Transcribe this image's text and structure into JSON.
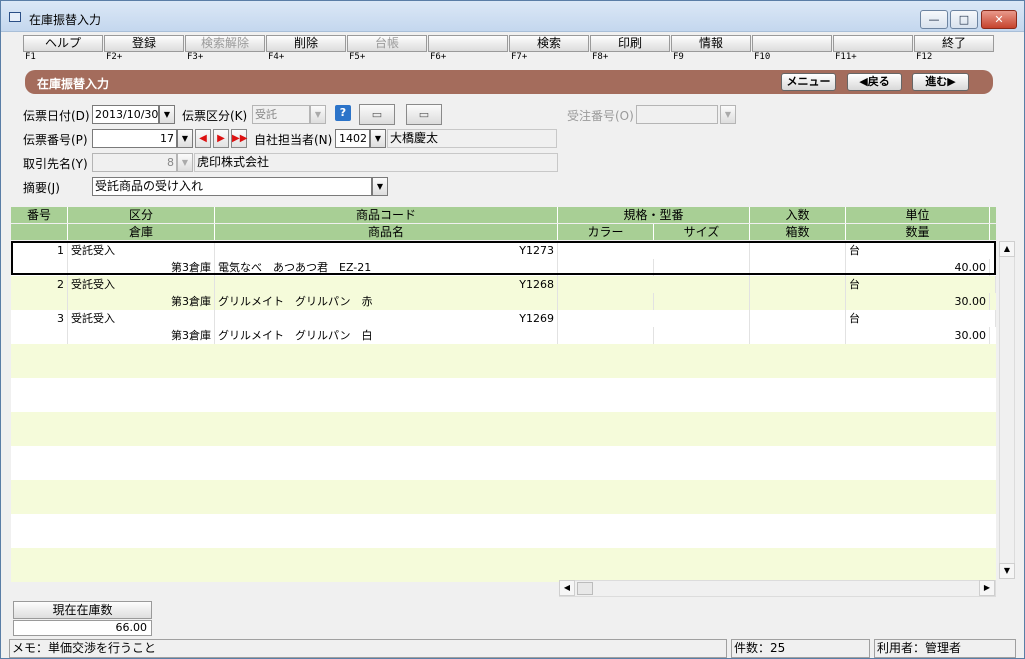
{
  "window": {
    "title": "在庫振替入力",
    "min": "—",
    "max": "□",
    "close": "✕"
  },
  "fkeys": [
    {
      "label": "ヘルプ",
      "code": "F1",
      "disabled": false
    },
    {
      "label": "登録",
      "code": "F2+",
      "disabled": false
    },
    {
      "label": "検索解除",
      "code": "F3+",
      "disabled": true
    },
    {
      "label": "削除",
      "code": "F4+",
      "disabled": false
    },
    {
      "label": "台帳",
      "code": "F5+",
      "disabled": true
    },
    {
      "label": "",
      "code": "F6+",
      "disabled": false
    },
    {
      "label": "検索",
      "code": "F7+",
      "disabled": false
    },
    {
      "label": "印刷",
      "code": "F8+",
      "disabled": false
    },
    {
      "label": "情報",
      "code": "F9",
      "disabled": false
    },
    {
      "label": "",
      "code": "F10",
      "disabled": false
    },
    {
      "label": "",
      "code": "F11+",
      "disabled": false
    },
    {
      "label": "終了",
      "code": "F12",
      "disabled": false
    }
  ],
  "banner": {
    "title": "在庫振替入力",
    "menu": "メニュー",
    "back": "◀戻る",
    "forward": "進む▶"
  },
  "form": {
    "slip_date_label": "伝票日付(D)",
    "slip_date": "2013/10/30",
    "slip_type_label": "伝票区分(K)",
    "slip_type": "受託",
    "help_icon": "?",
    "order_no_label": "受注番号(O)",
    "order_no": "",
    "slip_no_label": "伝票番号(P)",
    "slip_no": "17",
    "staff_label": "自社担当者(N)",
    "staff_code": "1402",
    "staff_name": "大橋慶太",
    "partner_label": "取引先名(Y)",
    "partner_code": "8",
    "partner_name": "虎印株式会社",
    "memo_label": "摘要(J)",
    "memo": "受託商品の受け入れ"
  },
  "grid": {
    "header1": [
      "番号",
      "区分",
      "商品コード",
      "規格・型番",
      "入数",
      "単位"
    ],
    "header2": [
      "倉庫",
      "商品名",
      "カラー",
      "サイズ",
      "箱数",
      "数量"
    ],
    "rows": [
      {
        "no": "1",
        "kubun": "受託受入",
        "code": "Y1273",
        "unit": "台",
        "warehouse": "第3倉庫",
        "name": "電気なべ　あつあつ君　EZ-21",
        "qty": "40.00"
      },
      {
        "no": "2",
        "kubun": "受託受入",
        "code": "Y1268",
        "unit": "台",
        "warehouse": "第3倉庫",
        "name": "グリルメイト　グリルパン　赤",
        "qty": "30.00"
      },
      {
        "no": "3",
        "kubun": "受託受入",
        "code": "Y1269",
        "unit": "台",
        "warehouse": "第3倉庫",
        "name": "グリルメイト　グリルパン　白",
        "qty": "30.00"
      }
    ]
  },
  "stock": {
    "label": "現在在庫数",
    "value": "66.00"
  },
  "status": {
    "memo": "メモ：単価交渉を行うこと",
    "count": "件数：25",
    "user": "利用者：管理者"
  }
}
